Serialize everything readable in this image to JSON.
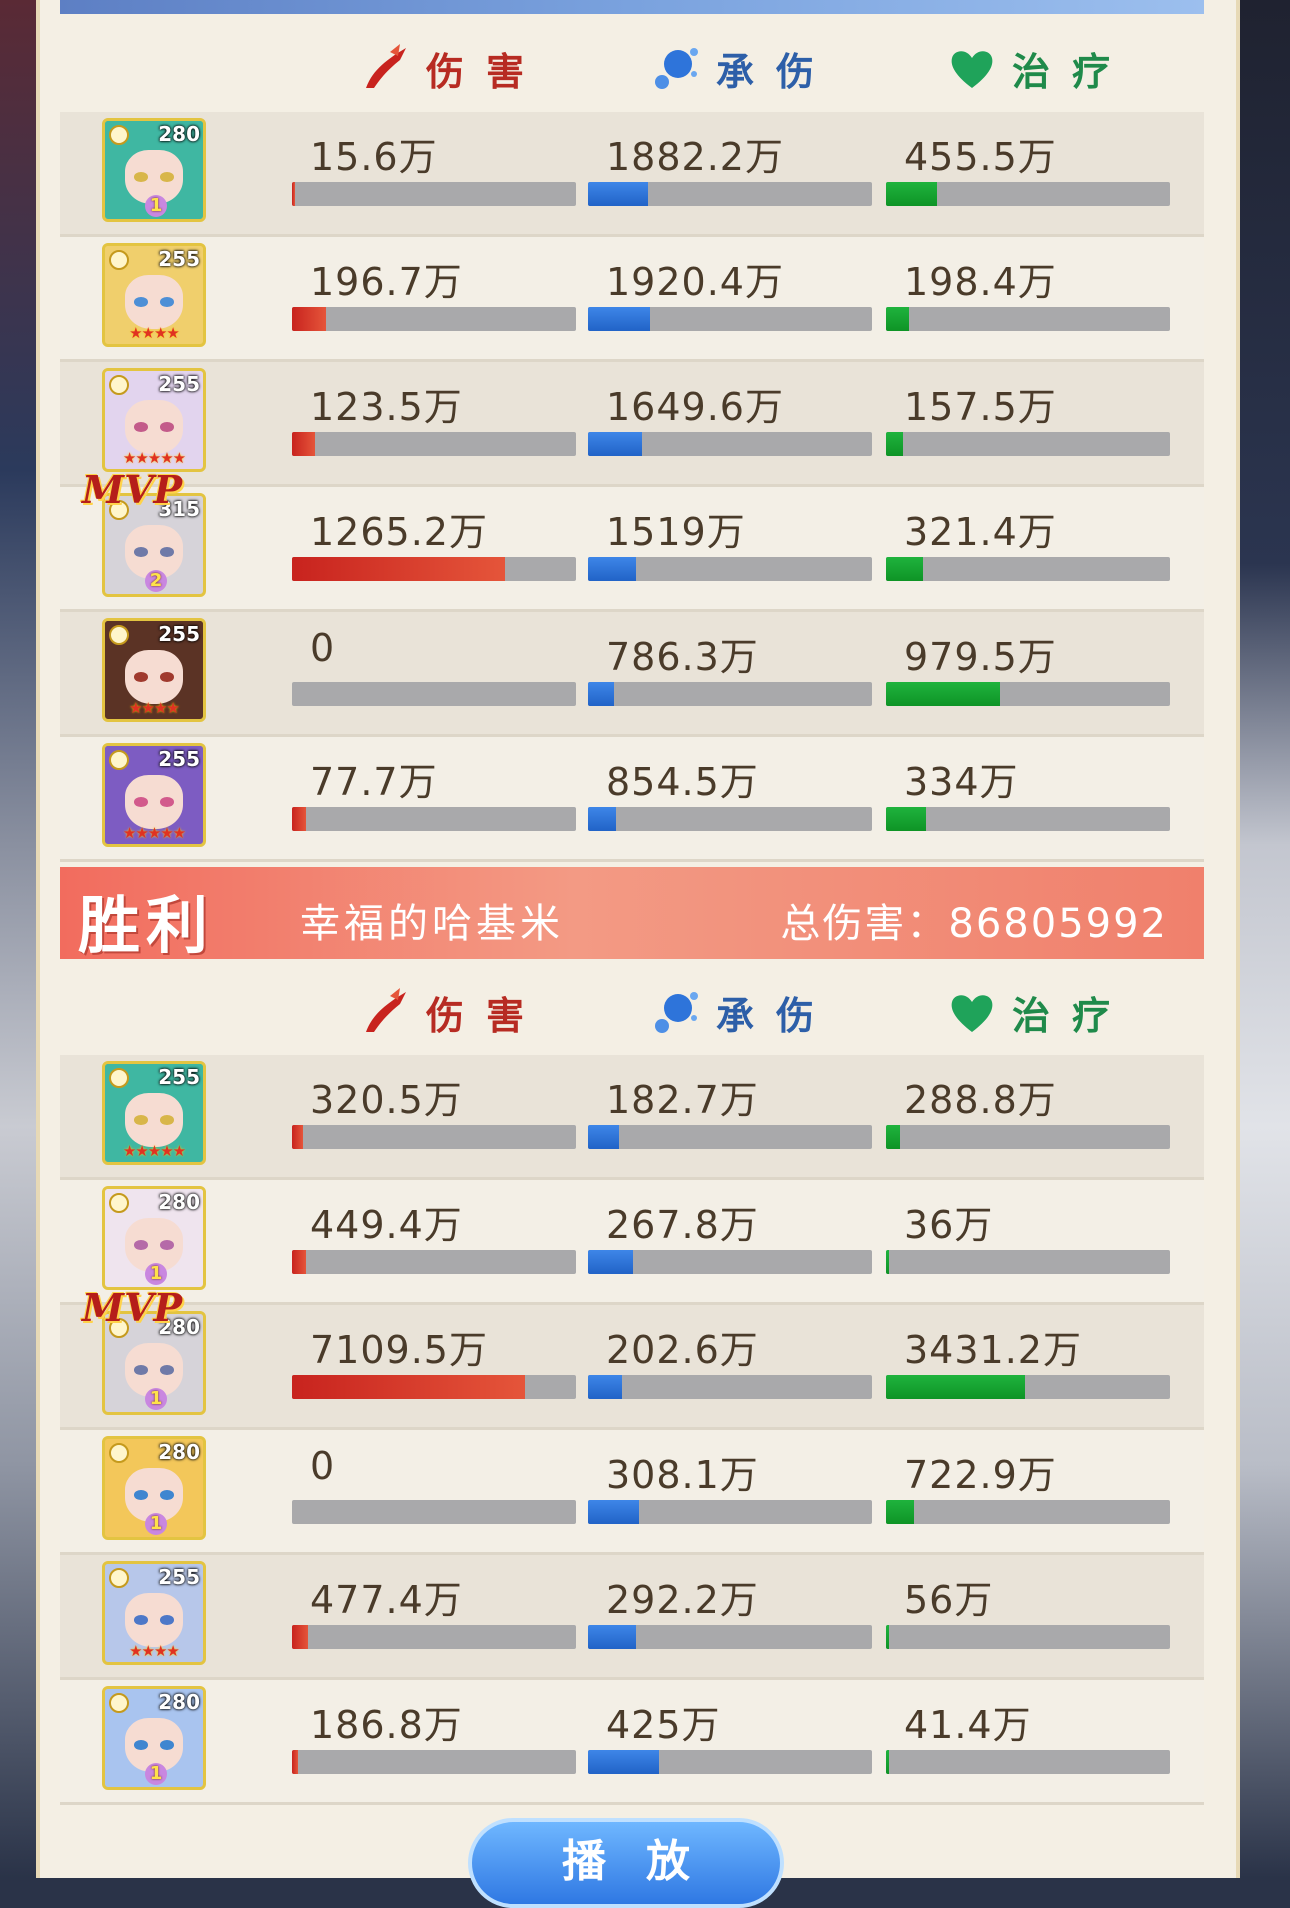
{
  "headers": {
    "damage": "伤害",
    "tank": "承伤",
    "heal": "治疗"
  },
  "colors": {
    "damage": "#c8231e",
    "tank": "#2e74da",
    "heal": "#14a332",
    "banner": "#f26c5e"
  },
  "team_top": {
    "players": [
      {
        "level": "280",
        "hair": "#3fb7a2",
        "eye": "#d8b64a",
        "stars": "",
        "rank": "1",
        "mvp": false,
        "damage": "15.6万",
        "tank": "1882.2万",
        "heal": "455.5万",
        "damage_ratio": 0.012,
        "tank_ratio": 0.21,
        "heal_ratio": 0.18
      },
      {
        "level": "255",
        "hair": "#f0cf6c",
        "eye": "#4d8fd6",
        "stars": "★★★★",
        "rank": "",
        "mvp": false,
        "damage": "196.7万",
        "tank": "1920.4万",
        "heal": "198.4万",
        "damage_ratio": 0.12,
        "tank_ratio": 0.22,
        "heal_ratio": 0.08
      },
      {
        "level": "255",
        "hair": "#e2d4ee",
        "eye": "#c35b8a",
        "stars": "★★★★★",
        "rank": "",
        "mvp": false,
        "damage": "123.5万",
        "tank": "1649.6万",
        "heal": "157.5万",
        "damage_ratio": 0.08,
        "tank_ratio": 0.19,
        "heal_ratio": 0.06
      },
      {
        "level": "315",
        "hair": "#d6d3d9",
        "eye": "#6f7aa8",
        "stars": "",
        "rank": "2",
        "mvp": true,
        "mvp_label": "MVP",
        "damage": "1265.2万",
        "tank": "1519万",
        "heal": "321.4万",
        "damage_ratio": 0.75,
        "tank_ratio": 0.17,
        "heal_ratio": 0.13
      },
      {
        "level": "255",
        "hair": "#5b3325",
        "eye": "#a03a2e",
        "stars": "★★★★",
        "rank": "",
        "mvp": false,
        "damage": "0",
        "tank": "786.3万",
        "heal": "979.5万",
        "damage_ratio": 0,
        "tank_ratio": 0.09,
        "heal_ratio": 0.4
      },
      {
        "level": "255",
        "hair": "#7d5cc2",
        "eye": "#d25a8c",
        "stars": "★★★★★",
        "rank": "",
        "mvp": false,
        "damage": "77.7万",
        "tank": "854.5万",
        "heal": "334万",
        "damage_ratio": 0.05,
        "tank_ratio": 0.1,
        "heal_ratio": 0.14
      }
    ]
  },
  "banner": {
    "victory": "胜利",
    "team_name": "幸福的哈基米",
    "total_damage": "总伤害：86805992"
  },
  "team_bottom": {
    "players": [
      {
        "level": "255",
        "hair": "#3fb7a2",
        "eye": "#d8b64a",
        "stars": "★★★★★",
        "rank": "",
        "mvp": false,
        "damage": "320.5万",
        "tank": "182.7万",
        "heal": "288.8万",
        "damage_ratio": 0.04,
        "tank_ratio": 0.11,
        "heal_ratio": 0.05
      },
      {
        "level": "280",
        "hair": "#efe4ee",
        "eye": "#b56aa8",
        "stars": "",
        "rank": "1",
        "mvp": false,
        "damage": "449.4万",
        "tank": "267.8万",
        "heal": "36万",
        "damage_ratio": 0.05,
        "tank_ratio": 0.16,
        "heal_ratio": 0.01
      },
      {
        "level": "280",
        "hair": "#d6d3d9",
        "eye": "#6f7aa8",
        "stars": "",
        "rank": "1",
        "mvp": true,
        "mvp_label": "MVP",
        "damage": "7109.5万",
        "tank": "202.6万",
        "heal": "3431.2万",
        "damage_ratio": 0.82,
        "tank_ratio": 0.12,
        "heal_ratio": 0.49
      },
      {
        "level": "280",
        "hair": "#f3c75a",
        "eye": "#3f86d0",
        "stars": "",
        "rank": "1",
        "mvp": false,
        "damage": "0",
        "tank": "308.1万",
        "heal": "722.9万",
        "damage_ratio": 0,
        "tank_ratio": 0.18,
        "heal_ratio": 0.1
      },
      {
        "level": "255",
        "hair": "#b7c7ea",
        "eye": "#4d78c8",
        "stars": "★★★★",
        "rank": "",
        "mvp": false,
        "damage": "477.4万",
        "tank": "292.2万",
        "heal": "56万",
        "damage_ratio": 0.055,
        "tank_ratio": 0.17,
        "heal_ratio": 0.01
      },
      {
        "level": "280",
        "hair": "#a9c4ef",
        "eye": "#3f86d0",
        "stars": "",
        "rank": "1",
        "mvp": false,
        "damage": "186.8万",
        "tank": "425万",
        "heal": "41.4万",
        "damage_ratio": 0.02,
        "tank_ratio": 0.25,
        "heal_ratio": 0.01
      }
    ]
  },
  "play_button": {
    "label": "播放"
  }
}
